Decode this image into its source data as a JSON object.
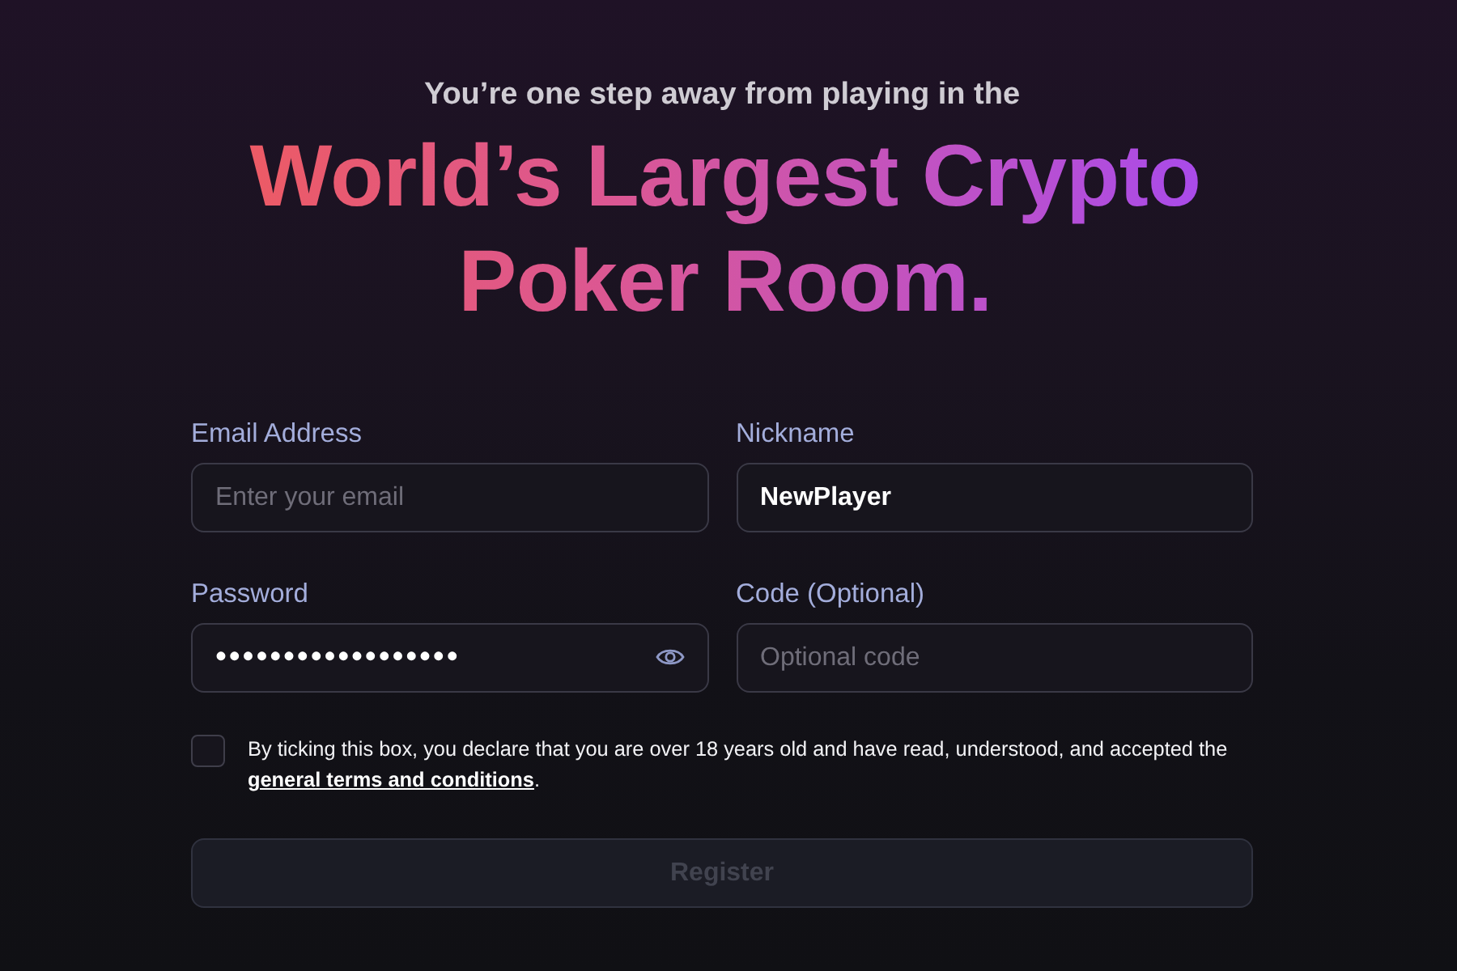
{
  "hero": {
    "subtitle": "You’re one step away from playing in the",
    "headline": "World’s Largest Crypto Poker Room."
  },
  "form": {
    "fields": [
      {
        "kind": "text",
        "label": "Email Address",
        "placeholder": "Enter your email"
      },
      {
        "kind": "text",
        "label": "Nickname",
        "value": "NewPlayer"
      },
      {
        "kind": "password",
        "label": "Password",
        "value": "••••••••••••••••••"
      },
      {
        "kind": "text",
        "label": "Code (Optional)",
        "placeholder": "Optional code"
      }
    ],
    "consent": {
      "checked": false,
      "text": "By ticking this box, you declare that you are over 18 years old and have read, understood, and accepted the",
      "link": "general terms and conditions",
      "after": "."
    },
    "submit": {
      "label": "Register",
      "disabled": true
    }
  }
}
